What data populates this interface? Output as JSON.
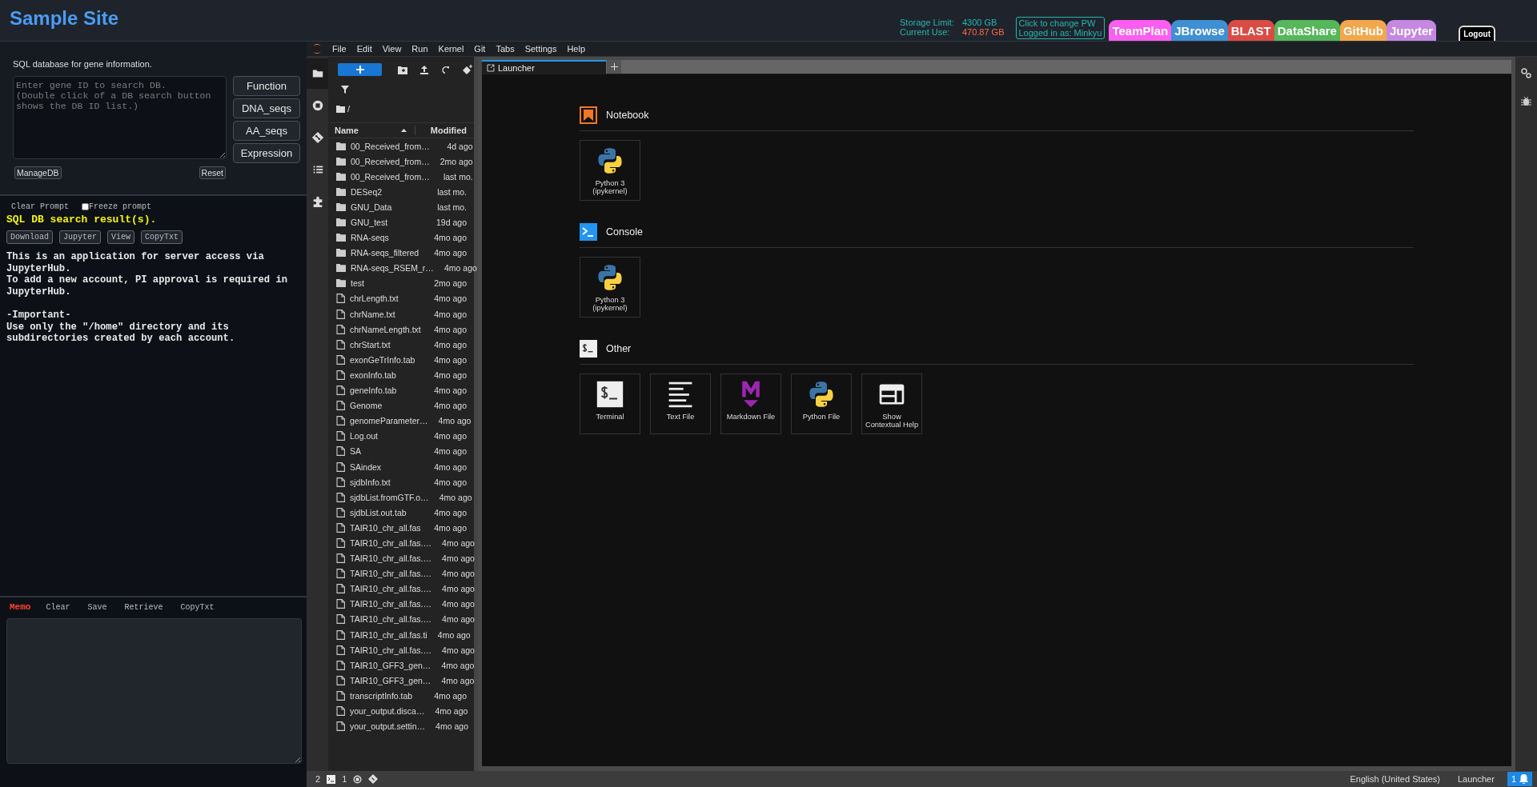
{
  "header": {
    "title": "Sample Site",
    "storage_limit_label": "Storage Limit:",
    "storage_limit": "4300 GB",
    "current_use_label": "Current Use:",
    "current_use": "470.87 GB",
    "account_lines": [
      "Click to change PW",
      "Logged in as: Minkyu"
    ],
    "nav_tabs": [
      {
        "label": "TeamPlan",
        "color": "#ff5ef0"
      },
      {
        "label": "JBrowse",
        "color": "#3f8fd2"
      },
      {
        "label": "BLAST",
        "color": "#db4b45"
      },
      {
        "label": "DataShare",
        "color": "#56b65a"
      },
      {
        "label": "GitHub",
        "color": "#f3a74c"
      },
      {
        "label": "Jupyter",
        "color": "#c488e0"
      }
    ],
    "logout": "Logout"
  },
  "gene_search": {
    "description": "SQL database for gene information.",
    "query": {
      "placeholder": "Enter gene ID to search DB.\n(Double click of a DB search button shows the DB ID list.)"
    },
    "search_buttons": [
      "Function",
      "DNA_seqs",
      "AA_seqs",
      "Expression"
    ],
    "manage_button": "ManageDB",
    "reset_button": "Reset"
  },
  "results": {
    "clear_prompt": "Clear Prompt",
    "freeze_prompt": {
      "label": "Freeze prompt",
      "checked": false
    },
    "heading": "SQL DB search result(s).",
    "actions": [
      "Download",
      "Jupyter",
      "View",
      "CopyTxt"
    ],
    "message": "This is an application for server access via\nJupyterHub.\nTo add a new account, PI approval is required in\nJupyterHub.\n\n-Important-\nUse only the \"/home\" directory and its\nsubdirectories created by each account."
  },
  "memo": {
    "title": "Memo",
    "actions": [
      "Clear",
      "Save",
      "Retrieve",
      "CopyTxt"
    ]
  },
  "jupyter": {
    "menu": [
      "File",
      "Edit",
      "View",
      "Run",
      "Kernel",
      "Git",
      "Tabs",
      "Settings",
      "Help"
    ],
    "left_sidebar": [
      {
        "kind": "files",
        "selected": true
      },
      {
        "kind": "running",
        "selected": false
      },
      {
        "kind": "git",
        "selected": false
      },
      {
        "kind": "toc",
        "selected": false
      },
      {
        "kind": "extensions",
        "selected": false
      }
    ],
    "file_browser": {
      "path": "/",
      "columns": [
        "Name",
        "Modified"
      ],
      "items": [
        {
          "name": "00_Received_from…",
          "modified": "4d ago",
          "kind": "folder"
        },
        {
          "name": "00_Received_from…",
          "modified": "2mo ago",
          "kind": "folder"
        },
        {
          "name": "00_Received_from…",
          "modified": "last mo.",
          "kind": "folder"
        },
        {
          "name": "DESeq2",
          "modified": "last mo.",
          "kind": "folder"
        },
        {
          "name": "GNU_Data",
          "modified": "last mo.",
          "kind": "folder"
        },
        {
          "name": "GNU_test",
          "modified": "19d ago",
          "kind": "folder"
        },
        {
          "name": "RNA-seqs",
          "modified": "4mo ago",
          "kind": "folder"
        },
        {
          "name": "RNA-seqs_filtered",
          "modified": "4mo ago",
          "kind": "folder"
        },
        {
          "name": "RNA-seqs_RSEM_r…",
          "modified": "4mo ago",
          "kind": "folder"
        },
        {
          "name": "test",
          "modified": "2mo ago",
          "kind": "folder"
        },
        {
          "name": "chrLength.txt",
          "modified": "4mo ago",
          "kind": "file"
        },
        {
          "name": "chrName.txt",
          "modified": "4mo ago",
          "kind": "file"
        },
        {
          "name": "chrNameLength.txt",
          "modified": "4mo ago",
          "kind": "file"
        },
        {
          "name": "chrStart.txt",
          "modified": "4mo ago",
          "kind": "file"
        },
        {
          "name": "exonGeTrInfo.tab",
          "modified": "4mo ago",
          "kind": "file"
        },
        {
          "name": "exonInfo.tab",
          "modified": "4mo ago",
          "kind": "file"
        },
        {
          "name": "geneInfo.tab",
          "modified": "4mo ago",
          "kind": "file"
        },
        {
          "name": "Genome",
          "modified": "4mo ago",
          "kind": "file"
        },
        {
          "name": "genomeParameter…",
          "modified": "4mo ago",
          "kind": "file"
        },
        {
          "name": "Log.out",
          "modified": "4mo ago",
          "kind": "file"
        },
        {
          "name": "SA",
          "modified": "4mo ago",
          "kind": "file"
        },
        {
          "name": "SAindex",
          "modified": "4mo ago",
          "kind": "file"
        },
        {
          "name": "sjdbInfo.txt",
          "modified": "4mo ago",
          "kind": "file"
        },
        {
          "name": "sjdbList.fromGTF.o…",
          "modified": "4mo ago",
          "kind": "file"
        },
        {
          "name": "sjdbList.out.tab",
          "modified": "4mo ago",
          "kind": "file"
        },
        {
          "name": "TAIR10_chr_all.fas",
          "modified": "4mo ago",
          "kind": "file"
        },
        {
          "name": "TAIR10_chr_all.fas.…",
          "modified": "4mo ago",
          "kind": "file"
        },
        {
          "name": "TAIR10_chr_all.fas.…",
          "modified": "4mo ago",
          "kind": "file"
        },
        {
          "name": "TAIR10_chr_all.fas.…",
          "modified": "4mo ago",
          "kind": "file"
        },
        {
          "name": "TAIR10_chr_all.fas.…",
          "modified": "4mo ago",
          "kind": "file"
        },
        {
          "name": "TAIR10_chr_all.fas.…",
          "modified": "4mo ago",
          "kind": "file"
        },
        {
          "name": "TAIR10_chr_all.fas.…",
          "modified": "4mo ago",
          "kind": "file"
        },
        {
          "name": "TAIR10_chr_all.fas.ti",
          "modified": "4mo ago",
          "kind": "file"
        },
        {
          "name": "TAIR10_chr_all.fas.…",
          "modified": "4mo ago",
          "kind": "file"
        },
        {
          "name": "TAIR10_GFF3_gen…",
          "modified": "4mo ago",
          "kind": "file"
        },
        {
          "name": "TAIR10_GFF3_gen…",
          "modified": "4mo ago",
          "kind": "file"
        },
        {
          "name": "transcriptInfo.tab",
          "modified": "4mo ago",
          "kind": "file"
        },
        {
          "name": "your_output.disca…",
          "modified": "4mo ago",
          "kind": "file"
        },
        {
          "name": "your_output.settin…",
          "modified": "4mo ago",
          "kind": "file"
        }
      ]
    },
    "tabs": [
      {
        "label": "Launcher",
        "selected": true
      }
    ],
    "launcher": [
      {
        "title": "Notebook",
        "kind": "notebook",
        "items": [
          {
            "label": "Python 3 (ipykernel)",
            "kind": "python"
          }
        ]
      },
      {
        "title": "Console",
        "kind": "console",
        "items": [
          {
            "label": "Python 3 (ipykernel)",
            "kind": "python"
          }
        ]
      },
      {
        "title": "Other",
        "kind": "other",
        "items": [
          {
            "label": "Terminal",
            "kind": "terminal"
          },
          {
            "label": "Text File",
            "kind": "text"
          },
          {
            "label": "Markdown File",
            "kind": "markdown"
          },
          {
            "label": "Python File",
            "kind": "python"
          },
          {
            "label": "Show Contextual Help",
            "kind": "help"
          }
        ]
      }
    ],
    "status_bar": {
      "terminals": "2",
      "kernels": "1",
      "language": "English (United States)",
      "mode": "Launcher",
      "notifications": "1"
    }
  }
}
